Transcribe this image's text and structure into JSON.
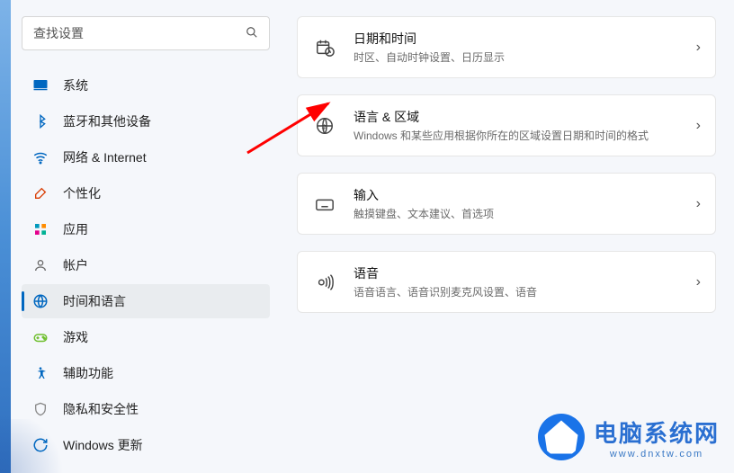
{
  "search": {
    "placeholder": "查找设置"
  },
  "sidebar": {
    "items": [
      {
        "label": "系统",
        "icon": "monitor-icon",
        "color": "#0067c0"
      },
      {
        "label": "蓝牙和其他设备",
        "icon": "bluetooth-icon",
        "color": "#0067c0"
      },
      {
        "label": "网络 & Internet",
        "icon": "wifi-icon",
        "color": "#0067c0"
      },
      {
        "label": "个性化",
        "icon": "brush-icon",
        "color": "#d83b01"
      },
      {
        "label": "应用",
        "icon": "apps-icon",
        "color": "#0099bc"
      },
      {
        "label": "帐户",
        "icon": "person-icon",
        "color": "#6b6b6b"
      },
      {
        "label": "时间和语言",
        "icon": "globe-clock-icon",
        "color": "#0067c0",
        "active": true
      },
      {
        "label": "游戏",
        "icon": "gamepad-icon",
        "color": "#6fbf2e"
      },
      {
        "label": "辅助功能",
        "icon": "accessibility-icon",
        "color": "#0067c0"
      },
      {
        "label": "隐私和安全性",
        "icon": "shield-icon",
        "color": "#8a8a8a"
      },
      {
        "label": "Windows 更新",
        "icon": "update-icon",
        "color": "#0067c0"
      }
    ]
  },
  "cards": [
    {
      "title": "日期和时间",
      "sub": "时区、自动时钟设置、日历显示",
      "icon": "calendar-clock-icon"
    },
    {
      "title": "语言 & 区域",
      "sub": "Windows 和某些应用根据你所在的区域设置日期和时间的格式",
      "icon": "globe-text-icon"
    },
    {
      "title": "输入",
      "sub": "触摸键盘、文本建议、首选项",
      "icon": "keyboard-icon"
    },
    {
      "title": "语音",
      "sub": "语音语言、语音识别麦克风设置、语音",
      "icon": "voice-icon"
    }
  ],
  "watermark": {
    "title": "电脑系统网",
    "url": "www.dnxtw.com"
  }
}
